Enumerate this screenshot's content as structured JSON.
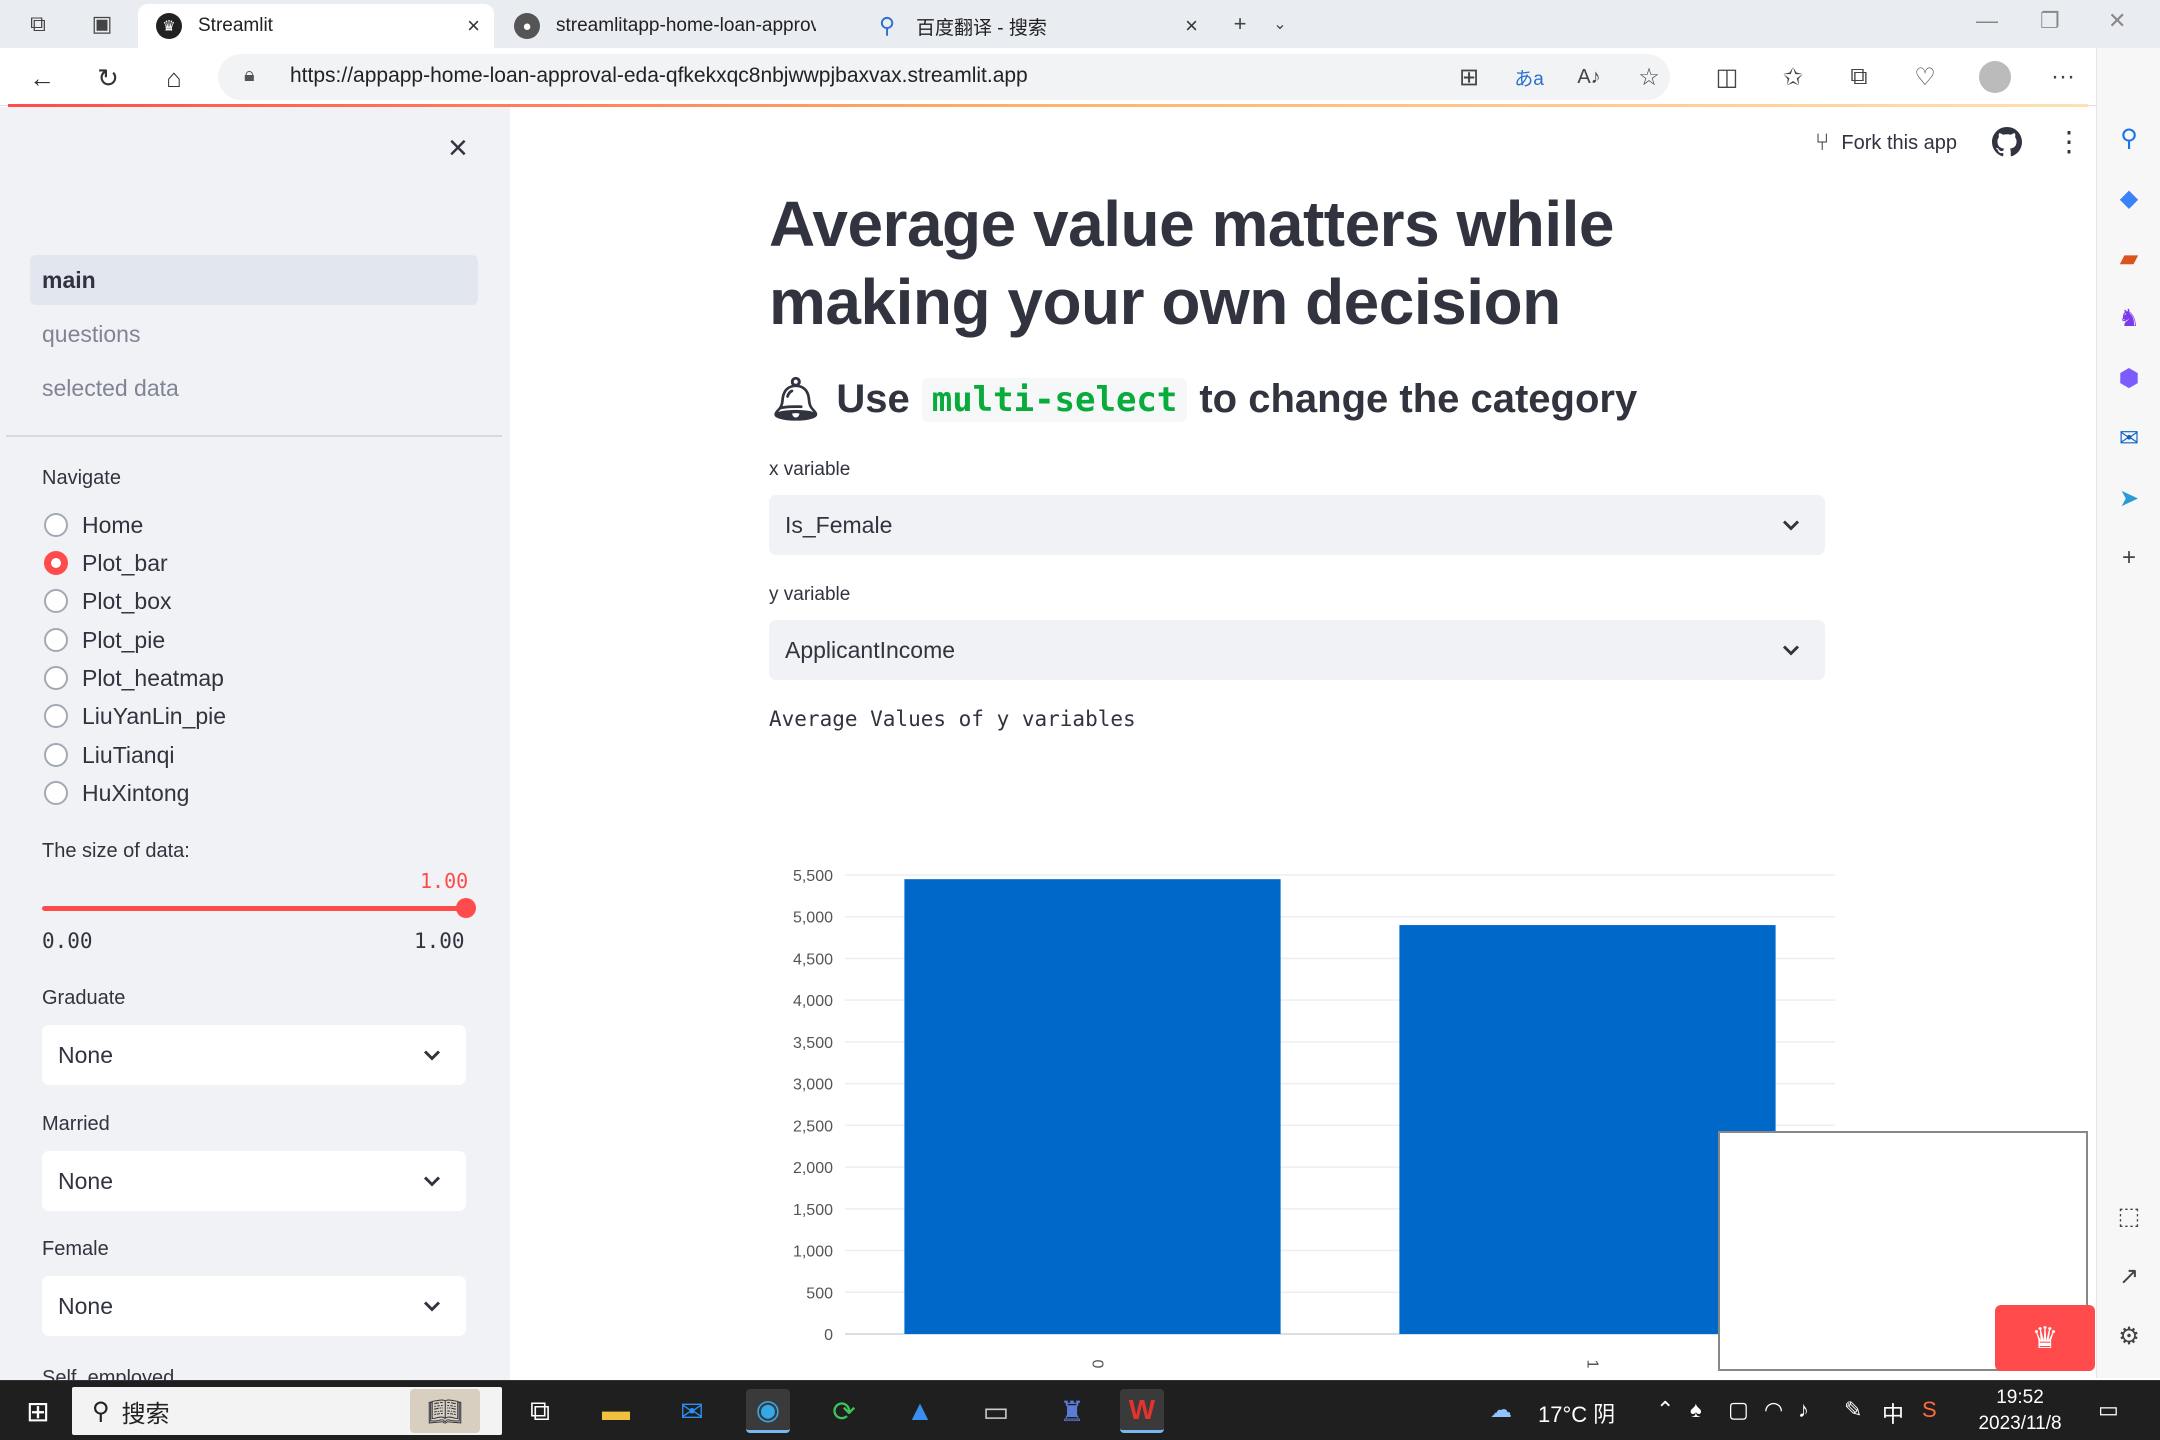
{
  "browser": {
    "tabs": [
      {
        "label": "Streamlit",
        "active": true
      },
      {
        "label": "streamlitapp-home-loan-approv",
        "active": false
      },
      {
        "label": "百度翻译 - 搜索",
        "active": false
      }
    ],
    "url": "https://appapp-home-loan-approval-eda-qfkekxqc8nbjwwpjbaxvax.streamlit.app",
    "accent": "#ff4b4b"
  },
  "sidebar": {
    "pages": [
      {
        "label": "main",
        "active": true
      },
      {
        "label": "questions",
        "active": false
      },
      {
        "label": "selected data",
        "active": false
      }
    ],
    "navigate": {
      "label": "Navigate",
      "options": [
        "Home",
        "Plot_bar",
        "Plot_box",
        "Plot_pie",
        "Plot_heatmap",
        "LiuYanLin_pie",
        "LiuTianqi",
        "HuXintong"
      ],
      "selected": "Plot_bar"
    },
    "slider": {
      "label": "The size of data:",
      "value": "1.00",
      "min": "0.00",
      "max": "1.00"
    },
    "filters": [
      {
        "label": "Graduate",
        "value": "None"
      },
      {
        "label": "Married",
        "value": "None"
      },
      {
        "label": "Female",
        "value": "None"
      }
    ],
    "cut_label": "Self_employed"
  },
  "main": {
    "toolbar": {
      "fork_label": "Fork this app"
    },
    "title": "Average value matters while making your own decision",
    "subheader": {
      "prefix": "Use",
      "code": "multi-select",
      "suffix": "to change the category"
    },
    "x_select": {
      "label": "x variable",
      "value": "Is_Female"
    },
    "y_select": {
      "label": "y variable",
      "value": "ApplicantIncome"
    }
  },
  "chart_data": {
    "type": "bar",
    "title": "Average Values of y variables",
    "categories": [
      "0",
      "1"
    ],
    "values": [
      5450,
      4900
    ],
    "ylim": [
      0,
      5500
    ],
    "yticks": [
      "0",
      "500",
      "1,000",
      "1,500",
      "2,000",
      "2,500",
      "3,000",
      "3,500",
      "4,000",
      "4,500",
      "5,000",
      "5,500"
    ],
    "color": "#0068c9",
    "grid": true
  },
  "taskbar": {
    "search_label": "搜索",
    "weather": "17°C 阴",
    "ime": "中",
    "time": "19:52",
    "date": "2023/11/8"
  }
}
